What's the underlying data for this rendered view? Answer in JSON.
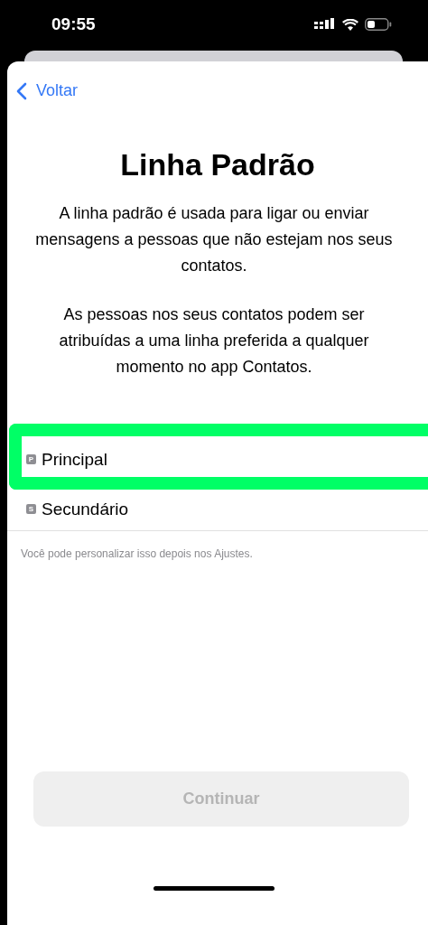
{
  "status_bar": {
    "time": "09:55"
  },
  "nav": {
    "back": "Voltar"
  },
  "title": "Linha Padrão",
  "paragraphs": [
    "A linha padrão é usada para ligar ou enviar mensagens a pessoas que não estejam nos seus contatos.",
    "As pessoas nos seus contatos podem ser atribuídas a uma linha preferida a qualquer momento no app Contatos."
  ],
  "lines": [
    {
      "badge": "P",
      "label": "Principal",
      "highlighted": true
    },
    {
      "badge": "S",
      "label": "Secundário",
      "highlighted": false
    }
  ],
  "footnote": "Você pode personalizar isso depois nos Ajustes.",
  "continue_button": {
    "label": "Continuar",
    "disabled": true
  }
}
